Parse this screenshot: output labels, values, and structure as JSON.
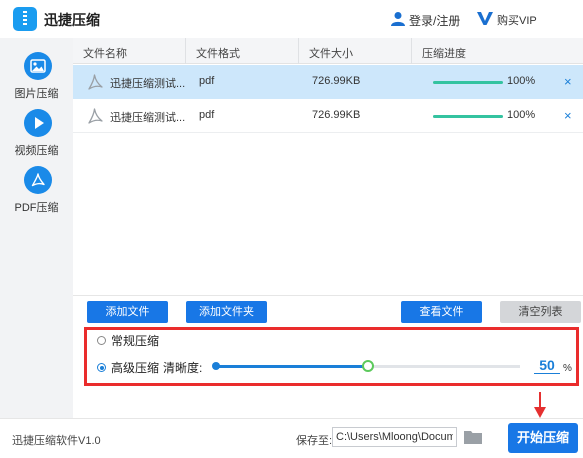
{
  "app": {
    "title": "迅捷压缩",
    "version": "迅捷压缩软件V1.0"
  },
  "header": {
    "login_label": "登录/注册",
    "vip_label": "购买VIP"
  },
  "sidebar": {
    "items": [
      {
        "label": "图片压缩",
        "icon": "image-icon"
      },
      {
        "label": "视频压缩",
        "icon": "video-play-icon"
      },
      {
        "label": "PDF压缩",
        "icon": "pdf-icon",
        "active": true
      }
    ]
  },
  "table": {
    "columns": [
      "文件名称",
      "文件格式",
      "文件大小",
      "压缩进度"
    ],
    "rows": [
      {
        "name": "迅捷压缩测试...",
        "format": "pdf",
        "size": "726.99KB",
        "progress": 1.0,
        "progress_label": "100%",
        "selected": true
      },
      {
        "name": "迅捷压缩测试...",
        "format": "pdf",
        "size": "726.99KB",
        "progress": 1.0,
        "progress_label": "100%",
        "selected": false
      }
    ],
    "remove_glyph": "×"
  },
  "toolbar": {
    "add_file": "添加文件",
    "add_folder": "添加文件夹",
    "view_file": "查看文件",
    "clear_list": "清空列表"
  },
  "options": {
    "normal_label": "常规压缩",
    "advanced_label": "高级压缩",
    "selected_mode": "advanced",
    "clarity_label": "清晰度:",
    "clarity_value": "50",
    "clarity_fraction": 0.5,
    "unit": "%"
  },
  "footer": {
    "save_label": "保存至:",
    "save_path": "C:\\Users\\Mloong\\Documents",
    "start_button": "开始压缩"
  },
  "colors": {
    "accent": "#1877e6",
    "highlight_border": "#ea2c2c",
    "progress": "#34c3a0",
    "selected_row": "#cde7fb"
  }
}
